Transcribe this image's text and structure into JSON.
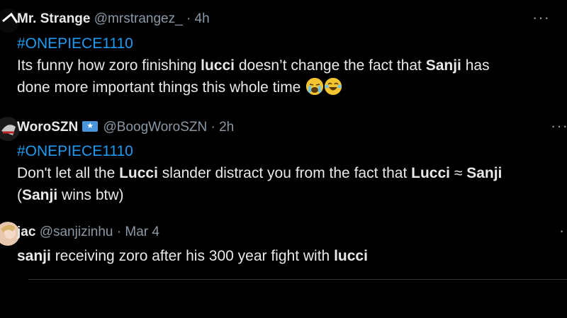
{
  "tweets": [
    {
      "name": "Mr. Strange",
      "handle": "@mrstrangez_",
      "time": "4h",
      "hashtag": "#ONEPIECE1110",
      "line1": [
        {
          "t": "Its funny how zoro finishing ",
          "b": false
        },
        {
          "t": "lucci",
          "b": true
        },
        {
          "t": " doesn’t change the fact that ",
          "b": false
        },
        {
          "t": "Sanji",
          "b": true
        },
        {
          "t": " has",
          "b": false
        }
      ],
      "line2_text": "done more important things this whole time ",
      "emojis": [
        "loudly-crying-face-emoji",
        "tears-of-joy-emoji"
      ]
    },
    {
      "name": "WoroSZN",
      "handle": "@BoogWoroSZN",
      "time": "2h",
      "hashtag": "#ONEPIECE1110",
      "line1": [
        {
          "t": "Don't let all the ",
          "b": false
        },
        {
          "t": "Lucci",
          "b": true
        },
        {
          "t": " slander distract you from the fact that ",
          "b": false
        },
        {
          "t": "Lucci",
          "b": true
        },
        {
          "t": " ≈ ",
          "b": false
        },
        {
          "t": "Sanji",
          "b": true
        }
      ],
      "line2": [
        {
          "t": "(",
          "b": false
        },
        {
          "t": "Sanji",
          "b": true
        },
        {
          "t": " wins btw)",
          "b": false
        }
      ]
    },
    {
      "name": "jac",
      "handle": "@sanjizinhu",
      "time": "Mar 4",
      "line1": [
        {
          "t": "sanji",
          "b": true
        },
        {
          "t": " receiving zoro after his 300 year fight with ",
          "b": false
        },
        {
          "t": "lucci",
          "b": true
        }
      ]
    }
  ],
  "separator": "·",
  "more_icon": "···",
  "colors": {
    "background": "#000000",
    "text": "#e7e9ea",
    "muted": "#8b98a5",
    "hashtag": "#1d9bf0"
  }
}
